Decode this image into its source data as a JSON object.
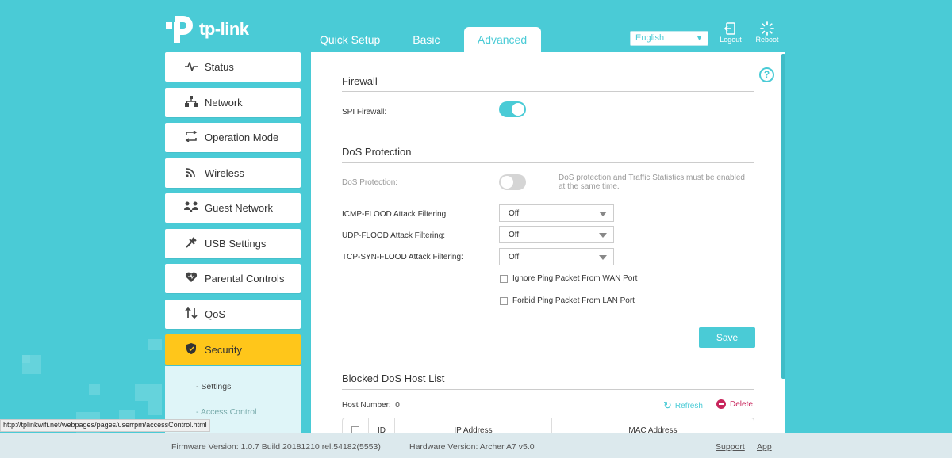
{
  "header": {
    "logo_text": "tp-link",
    "tabs": [
      "Quick Setup",
      "Basic",
      "Advanced"
    ],
    "language": "English",
    "logout_label": "Logout",
    "reboot_label": "Reboot",
    "accent_color": "#4acbd6"
  },
  "sidebar": {
    "items": [
      {
        "label": "Status",
        "icon": "pulse-icon"
      },
      {
        "label": "Network",
        "icon": "network-icon"
      },
      {
        "label": "Operation Mode",
        "icon": "mode-switch-icon"
      },
      {
        "label": "Wireless",
        "icon": "wireless-icon"
      },
      {
        "label": "Guest Network",
        "icon": "guest-icon"
      },
      {
        "label": "USB Settings",
        "icon": "usb-icon"
      },
      {
        "label": "Parental Controls",
        "icon": "heart-icon"
      },
      {
        "label": "QoS",
        "icon": "qos-arrows-icon"
      },
      {
        "label": "Security",
        "icon": "shield-icon"
      }
    ],
    "active": "Security",
    "active_color": "#ffc61a",
    "subitems": [
      "- Settings",
      "- Access Control"
    ]
  },
  "main": {
    "firewall": {
      "title": "Firewall",
      "spi_label": "SPI Firewall:",
      "spi_enabled": true
    },
    "dos": {
      "title": "DoS Protection",
      "dos_label": "DoS Protection:",
      "dos_enabled": false,
      "note": "DoS protection and Traffic Statistics must be enabled at the same time.",
      "icmp_label": "ICMP-FLOOD Attack Filtering:",
      "icmp_value": "Off",
      "udp_label": "UDP-FLOOD Attack Filtering:",
      "udp_value": "Off",
      "tcp_label": "TCP-SYN-FLOOD Attack Filtering:",
      "tcp_value": "Off",
      "ignore_ping_label": "Ignore Ping Packet From WAN Port",
      "forbid_ping_label": "Forbid Ping Packet From LAN Port",
      "save_label": "Save"
    },
    "blocked": {
      "title": "Blocked DoS Host List",
      "host_number_label": "Host Number:",
      "host_number": "0",
      "refresh_label": "Refresh",
      "delete_label": "Delete",
      "columns": [
        "ID",
        "IP Address",
        "MAC Address"
      ]
    }
  },
  "footer": {
    "firmware": "Firmware Version: 1.0.7 Build 20181210 rel.54182(5553)",
    "hardware": "Hardware Version: Archer A7 v5.0",
    "support": "Support",
    "app": "App"
  },
  "statusbar_url": "http://tplinkwifi.net/webpages/pages/userrpm/accessControl.html"
}
